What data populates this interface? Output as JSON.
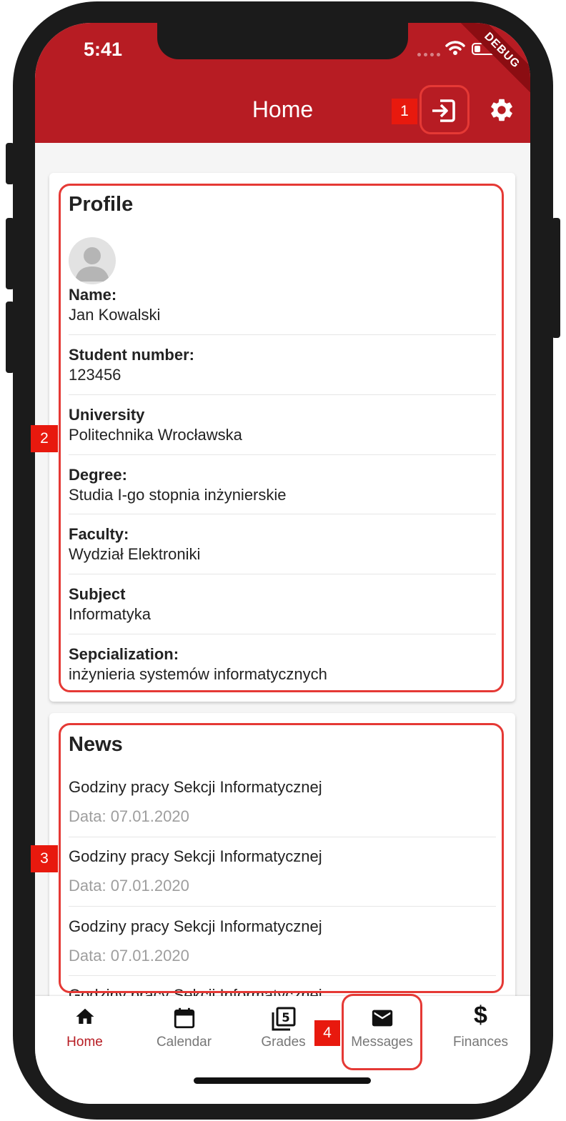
{
  "status_bar": {
    "time": "5:41",
    "debug_banner": "DEBUG"
  },
  "app_bar": {
    "title": "Home",
    "login_icon": "login-icon",
    "settings_icon": "gear-icon"
  },
  "profile": {
    "title": "Profile",
    "fields": [
      {
        "label": "Name:",
        "value": "Jan Kowalski"
      },
      {
        "label": "Student number:",
        "value": "123456"
      },
      {
        "label": "University",
        "value": "Politechnika Wrocławska"
      },
      {
        "label": "Degree:",
        "value": "Studia I-go stopnia inżynierskie"
      },
      {
        "label": "Faculty:",
        "value": "Wydział Elektroniki"
      },
      {
        "label": "Subject",
        "value": "Informatyka"
      },
      {
        "label": "Sepcialization:",
        "value": "inżynieria systemów informatycznych"
      }
    ]
  },
  "news": {
    "title": "News",
    "items": [
      {
        "title": "Godziny pracy Sekcji Informatycznej",
        "date": "Data: 07.01.2020"
      },
      {
        "title": "Godziny pracy Sekcji Informatycznej",
        "date": "Data: 07.01.2020"
      },
      {
        "title": "Godziny pracy Sekcji Informatycznej",
        "date": "Data: 07.01.2020"
      },
      {
        "title": "Godziny pracy Sekcji Informatycznej",
        "date": ""
      }
    ]
  },
  "bottom_nav": {
    "active": "Home",
    "active_color": "#b71c23",
    "items": [
      {
        "label": "Home",
        "icon": "home-icon"
      },
      {
        "label": "Calendar",
        "icon": "calendar-icon"
      },
      {
        "label": "Grades",
        "icon": "grades-icon"
      },
      {
        "label": "Messages",
        "icon": "mail-icon"
      },
      {
        "label": "Finances",
        "icon": "dollar-icon"
      }
    ]
  },
  "annotations": {
    "markers": [
      "1",
      "2",
      "3",
      "4"
    ],
    "highlight_color": "#e53935"
  }
}
